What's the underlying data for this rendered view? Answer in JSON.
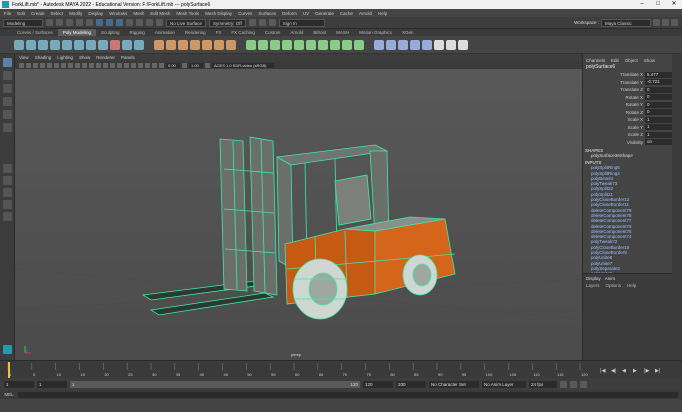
{
  "window": {
    "title": "ForkLift.mb* - Autodesk MAYA 2022 - Educational Version: F:\\ForkLift.mb    ---    polySurface6"
  },
  "menubar": {
    "items": [
      "File",
      "Edit",
      "Create",
      "Select",
      "Modify",
      "Display",
      "Windows",
      "Mesh",
      "Edit Mesh",
      "Mesh Tools",
      "Mesh Display",
      "Curves",
      "Surfaces",
      "Deform",
      "UV",
      "Generate",
      "Cache",
      "Arnold",
      "Help"
    ]
  },
  "statusline": {
    "menuset": "Modeling",
    "live_surface": "No Live Surface",
    "symmetry": "Symmetry: Off",
    "signin": "Sign In",
    "workspace_label": "Workspace :",
    "workspace": "Maya Classic"
  },
  "shelf": {
    "tabs": [
      "Curves / Surfaces",
      "Poly Modeling",
      "Sculpting",
      "Rigging",
      "Animation",
      "Rendering",
      "FX",
      "FX Caching",
      "Custom",
      "Arnold",
      "Bifrost",
      "MASH",
      "Motion Graphics",
      "XGen"
    ],
    "active": "Poly Modeling"
  },
  "viewport": {
    "menu": [
      "View",
      "Shading",
      "Lighting",
      "Show",
      "Renderer",
      "Panels"
    ],
    "near": "0.00",
    "zoom": "1.00",
    "colorspace": "ACES 1.0 SDR-video (sRGB)",
    "camera": "persp"
  },
  "channelbox": {
    "menu": [
      "Channels",
      "Edit",
      "Object",
      "Show"
    ],
    "object": "polySurface6",
    "attributes": [
      {
        "name": "Translate X",
        "value": "5.477"
      },
      {
        "name": "Translate Y",
        "value": "-0.721"
      },
      {
        "name": "Translate Z",
        "value": "0"
      },
      {
        "name": "Rotate X",
        "value": "0"
      },
      {
        "name": "Rotate Y",
        "value": "0"
      },
      {
        "name": "Rotate Z",
        "value": "0"
      },
      {
        "name": "Scale X",
        "value": "1"
      },
      {
        "name": "Scale Y",
        "value": "1"
      },
      {
        "name": "Scale Z",
        "value": "1"
      },
      {
        "name": "Visibility",
        "value": "on"
      }
    ],
    "shapes_label": "SHAPES",
    "shape": "polySurface36Shape",
    "inputs_label": "INPUTS",
    "inputs": [
      "polySplitRing5",
      "polySplitRing4",
      "polyBevel4",
      "polyTweak73",
      "polySplit22",
      "polySplit21",
      "polyCloseBorder12",
      "polyCloseBorder11",
      "deleteComponent79",
      "deleteComponent78",
      "deleteComponent77",
      "deleteComponent76",
      "deleteComponent75",
      "deleteComponent74",
      "polyTweak72",
      "polyCloseBorder10",
      "polyCloseBorder9",
      "polyUnite8",
      "polyUnite7",
      "polySeparate2",
      "polyUnite3",
      "polyTweakUV36"
    ]
  },
  "layers": {
    "tabs": [
      "Display",
      "Anim"
    ],
    "menu": [
      "Layers",
      "Options",
      "Help"
    ]
  },
  "timeline": {
    "ticks": [
      "1",
      "5",
      "10",
      "15",
      "20",
      "25",
      "30",
      "35",
      "40",
      "45",
      "50",
      "55",
      "60",
      "65",
      "70",
      "75",
      "80",
      "85",
      "90",
      "95",
      "100",
      "105",
      "110",
      "115",
      "120"
    ],
    "current": "1"
  },
  "range": {
    "start": "1",
    "start2": "1",
    "range_inner": "1",
    "range_end": "120",
    "end": "120",
    "end2": "200",
    "char_set": "No Character Set",
    "anim_layer": "No Anim Layer",
    "fps": "24 fps"
  },
  "cmdline": {
    "label": "MEL"
  },
  "colors": {
    "wire": "#3fe8a8",
    "body": "#c65a12",
    "viewport": "#555555"
  }
}
